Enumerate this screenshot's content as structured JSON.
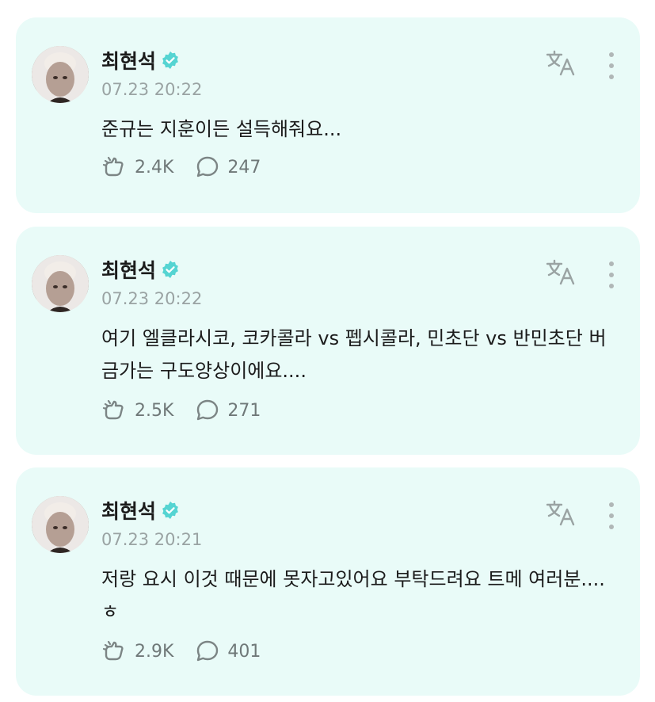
{
  "posts": [
    {
      "author": "최현석",
      "time": "07.23 20:22",
      "text": "준규는 지훈이든 설득해줘요...",
      "likes": "2.4K",
      "comments": "247"
    },
    {
      "author": "최현석",
      "time": "07.23 20:22",
      "text": "여기 엘클라시코, 코카콜라 vs 펩시콜라, 민초단 vs 반민초단 버금가는 구도양상이에요....",
      "likes": "2.5K",
      "comments": "271"
    },
    {
      "author": "최현석",
      "time": "07.23 20:21",
      "text": "저랑 요시 이것 때문에 못자고있어요 부탁드려요 트메 여러분....ㅎ",
      "likes": "2.9K",
      "comments": "401"
    }
  ],
  "colors": {
    "card_bg": "#e9fbf8",
    "verified": "#55d4d2",
    "muted": "#9aa3a3"
  },
  "icons": [
    "verified-badge-icon",
    "translate-icon",
    "more-options-icon",
    "like-icon",
    "comment-icon"
  ]
}
